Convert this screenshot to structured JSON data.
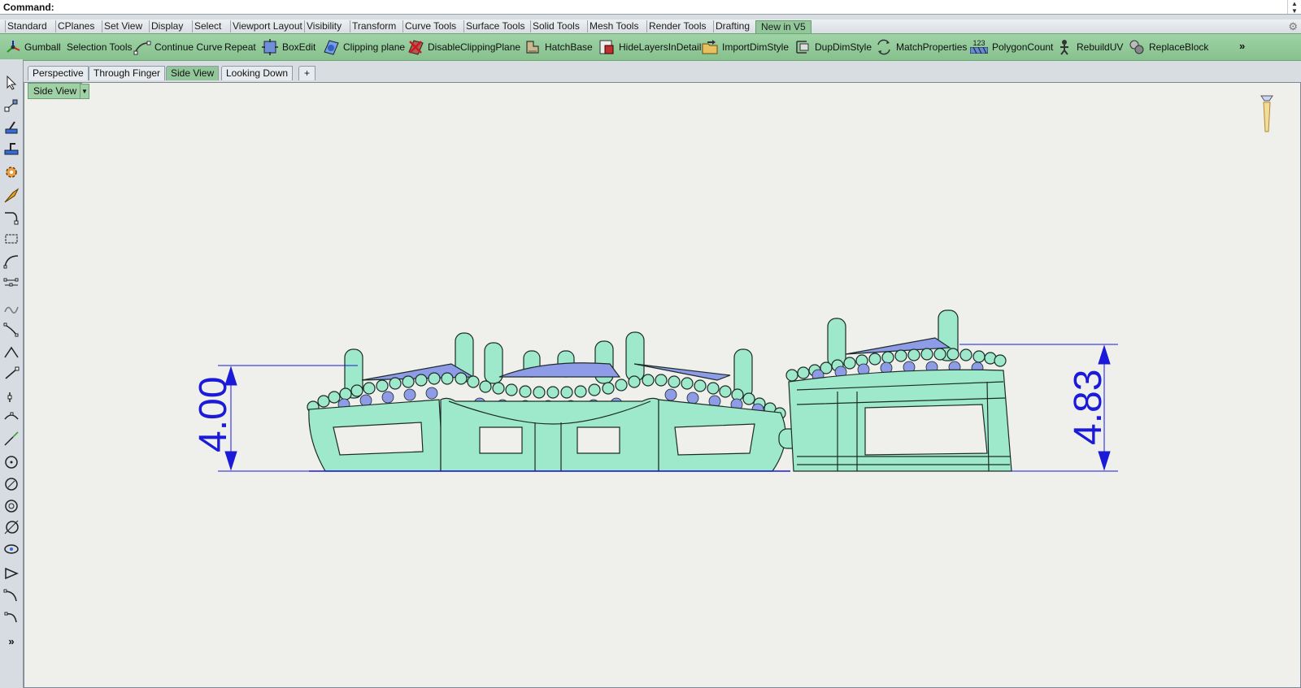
{
  "command": {
    "label": "Command:",
    "value": ""
  },
  "toolbar_tabs": [
    "Standard",
    "CPlanes",
    "Set View",
    "Display",
    "Select",
    "Viewport Layout",
    "Visibility",
    "Transform",
    "Curve Tools",
    "Surface Tools",
    "Solid Tools",
    "Mesh Tools",
    "Render Tools",
    "Drafting",
    "New in V5"
  ],
  "active_toolbar_tab": "New in V5",
  "tools": [
    {
      "label": "Gumball",
      "icon": "gumball-icon"
    },
    {
      "label": "Selection Tools",
      "icon": ""
    },
    {
      "label": "Continue Curve",
      "icon": "continue-curve-icon"
    },
    {
      "label": "Repeat",
      "icon": ""
    },
    {
      "label": "BoxEdit",
      "icon": "boxedit-icon"
    },
    {
      "label": "Clipping plane",
      "icon": "clipping-plane-icon"
    },
    {
      "label": "DisableClippingPlane",
      "icon": "disable-clipping-plane-icon"
    },
    {
      "label": "HatchBase",
      "icon": "hatchbase-icon"
    },
    {
      "label": "HideLayersInDetail",
      "icon": "hide-layers-icon"
    },
    {
      "label": "ImportDimStyle",
      "icon": "import-dimstyle-icon"
    },
    {
      "label": "DupDimStyle",
      "icon": "dup-dimstyle-icon"
    },
    {
      "label": "MatchProperties",
      "icon": "match-properties-icon"
    },
    {
      "label": "PolygonCount",
      "icon": "polygon-count-icon",
      "badge": "123"
    },
    {
      "label": "RebuildUV",
      "icon": "rebuild-uv-icon"
    },
    {
      "label": "ReplaceBlock",
      "icon": "replace-block-icon"
    }
  ],
  "toolbar_more": "»",
  "left_more": "»",
  "viewport_tabs": [
    "Perspective",
    "Through Finger",
    "Side View",
    "Looking Down"
  ],
  "active_viewport_tab": "Side View",
  "add_tab_label": "+",
  "viewport": {
    "title": "Side View"
  },
  "dimensions": {
    "left": "4.00",
    "right": "4.83"
  },
  "colors": {
    "accent_green": "#92c79a",
    "model_fill": "#9ee9cc",
    "gem_fill": "#8e9be6",
    "dimension": "#1a1ad8"
  }
}
